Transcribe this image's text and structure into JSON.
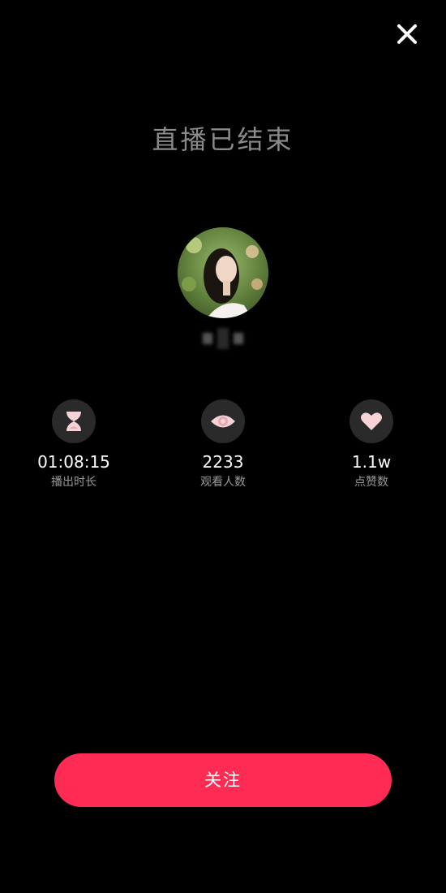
{
  "header": {
    "close_icon": "close-icon",
    "title": "直播已结束"
  },
  "profile": {
    "avatar_icon": "avatar-photo"
  },
  "stats": [
    {
      "icon": "hourglass-icon",
      "value": "01:08:15",
      "label": "播出时长"
    },
    {
      "icon": "eye-icon",
      "value": "2233",
      "label": "观看人数"
    },
    {
      "icon": "heart-icon",
      "value": "1.1w",
      "label": "点赞数"
    }
  ],
  "actions": {
    "follow_label": "关注"
  },
  "colors": {
    "background": "#000000",
    "accent": "#fe2c55",
    "icon_pink": "#f6d3d6",
    "icon_circle": "#2a2a2a",
    "title_gray": "#8a8a8a"
  }
}
